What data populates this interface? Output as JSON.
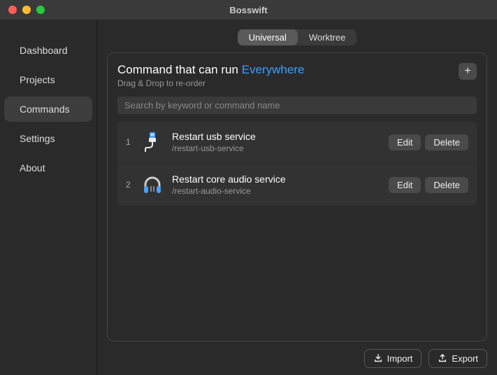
{
  "window": {
    "title": "Bosswift"
  },
  "sidebar": {
    "items": [
      {
        "label": "Dashboard"
      },
      {
        "label": "Projects"
      },
      {
        "label": "Commands"
      },
      {
        "label": "Settings"
      },
      {
        "label": "About"
      }
    ]
  },
  "tabs": {
    "universal": "Universal",
    "worktree": "Worktree"
  },
  "header": {
    "title_prefix": "Command that can run ",
    "title_scope": "Everywhere",
    "subtitle": "Drag & Drop to re-order",
    "add_label": "+"
  },
  "search": {
    "placeholder": "Search by keyword or command name",
    "value": ""
  },
  "commands": [
    {
      "num": "1",
      "name": "Restart usb service",
      "cmd": "/restart-usb-service",
      "icon": "usb"
    },
    {
      "num": "2",
      "name": "Restart core audio service",
      "cmd": "/restart-audio-service",
      "icon": "headphones"
    }
  ],
  "buttons": {
    "edit": "Edit",
    "delete": "Delete",
    "import": "Import",
    "export": "Export"
  }
}
